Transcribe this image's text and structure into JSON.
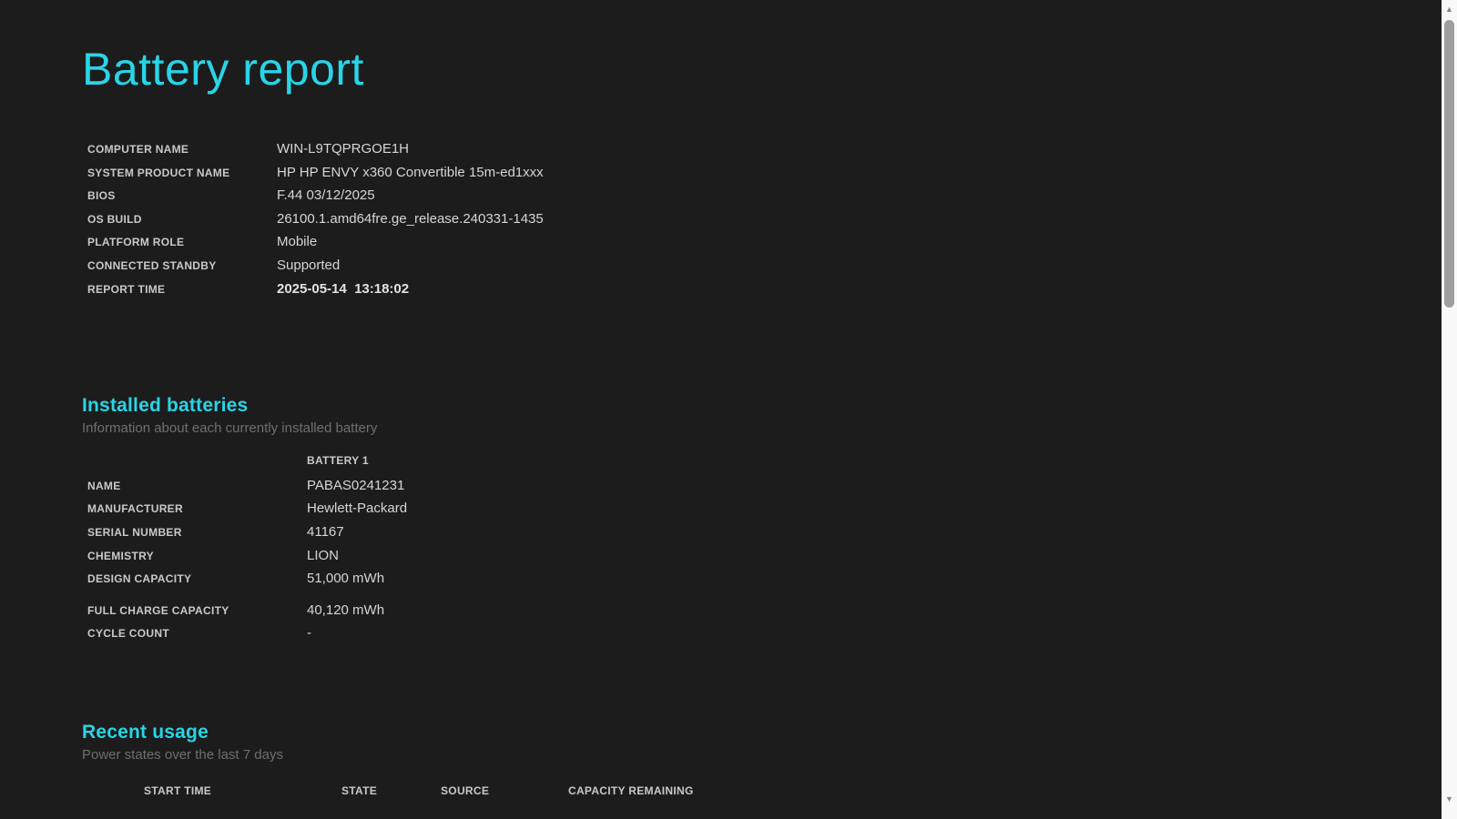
{
  "page": {
    "title": "Battery report",
    "colors": {
      "background": "#1c1c1c",
      "accent_cyan": "#29d4e6",
      "label_text": "#c9c9c9",
      "value_text": "#d6d6d6",
      "muted_text": "#6f6f6f",
      "scroll_track": "#f8f8f8",
      "scroll_thumb": "#9e9e9e"
    }
  },
  "system_info": {
    "rows": [
      {
        "label": "COMPUTER NAME",
        "value": "WIN-L9TQPRGOE1H"
      },
      {
        "label": "SYSTEM PRODUCT NAME",
        "value": "HP HP ENVY x360 Convertible 15m-ed1xxx"
      },
      {
        "label": "BIOS",
        "value": "F.44 03/12/2025"
      },
      {
        "label": "OS BUILD",
        "value": "26100.1.amd64fre.ge_release.240331-1435"
      },
      {
        "label": "PLATFORM ROLE",
        "value": "Mobile"
      },
      {
        "label": "CONNECTED STANDBY",
        "value": "Supported"
      },
      {
        "label": "REPORT TIME",
        "value": "2025-05-14  13:18:02"
      }
    ]
  },
  "installed_batteries": {
    "heading": "Installed batteries",
    "subtitle": "Information about each currently installed battery",
    "column_header": "BATTERY 1",
    "rows_group1": [
      {
        "label": "NAME",
        "value": "PABAS0241231"
      },
      {
        "label": "MANUFACTURER",
        "value": "Hewlett-Packard"
      },
      {
        "label": "SERIAL NUMBER",
        "value": "41167"
      },
      {
        "label": "CHEMISTRY",
        "value": "LION"
      },
      {
        "label": "DESIGN CAPACITY",
        "value": "51,000 mWh"
      }
    ],
    "rows_group2": [
      {
        "label": "FULL CHARGE CAPACITY",
        "value": "40,120 mWh"
      },
      {
        "label": "CYCLE COUNT",
        "value": "-"
      }
    ]
  },
  "recent_usage": {
    "heading": "Recent usage",
    "subtitle": "Power states over the last 7 days",
    "table_headers": [
      "START TIME",
      "STATE",
      "SOURCE",
      "CAPACITY REMAINING"
    ]
  },
  "icons": {
    "scroll_up": "▲",
    "scroll_down": "▼"
  }
}
